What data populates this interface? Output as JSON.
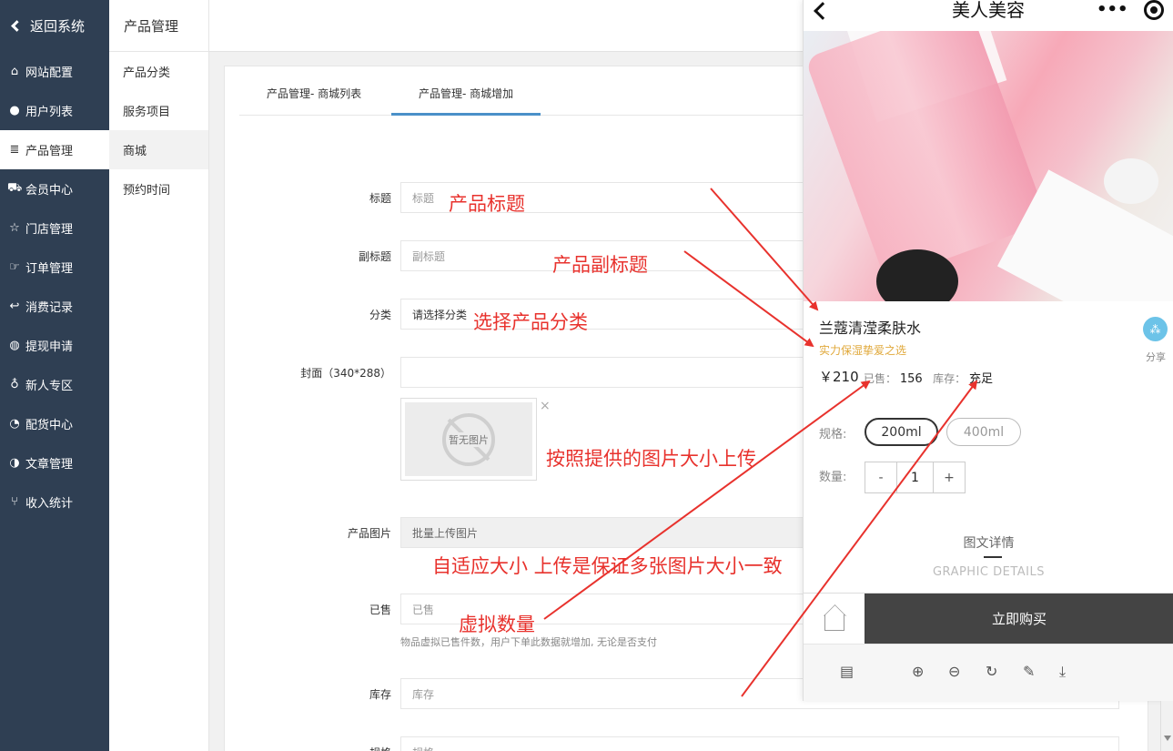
{
  "sidebar": {
    "back_label": "返回系统",
    "items": [
      {
        "label": "网站配置",
        "icon": "home-icon",
        "glyph": "⌂"
      },
      {
        "label": "用户列表",
        "icon": "user-icon",
        "glyph": "●"
      },
      {
        "label": "产品管理",
        "icon": "server-icon",
        "glyph": "≣"
      },
      {
        "label": "会员中心",
        "icon": "cart-icon",
        "glyph": "⛟"
      },
      {
        "label": "门店管理",
        "icon": "star-icon",
        "glyph": "☆"
      },
      {
        "label": "订单管理",
        "icon": "thumb-icon",
        "glyph": "☞"
      },
      {
        "label": "消费记录",
        "icon": "reply-icon",
        "glyph": "↩"
      },
      {
        "label": "提现申请",
        "icon": "wechat-icon",
        "glyph": "◍"
      },
      {
        "label": "新人专区",
        "icon": "pin-icon",
        "glyph": "♁"
      },
      {
        "label": "配货中心",
        "icon": "pie-icon",
        "glyph": "◔"
      },
      {
        "label": "文章管理",
        "icon": "contrast-icon",
        "glyph": "◑"
      },
      {
        "label": "收入统计",
        "icon": "fork-icon",
        "glyph": "⑂"
      }
    ]
  },
  "submenu": {
    "title": "产品管理",
    "items": [
      "产品分类",
      "服务项目",
      "商城",
      "预约时间"
    ]
  },
  "tabs": [
    "产品管理- 商城列表",
    "产品管理- 商城增加"
  ],
  "form": {
    "title_label": "标题",
    "title_placeholder": "标题",
    "subtitle_label": "副标题",
    "subtitle_placeholder": "副标题",
    "category_label": "分类",
    "category_value": "请选择分类",
    "cover_label": "封面（340*288）",
    "cover_noimg": "暂无图片",
    "cover_close": "×",
    "images_label": "产品图片",
    "images_button": "批量上传图片",
    "sold_label": "已售",
    "sold_placeholder": "已售",
    "sold_hint": "物品虚拟已售件数，用户下单此数据就增加, 无论是否支付",
    "stock_label": "库存",
    "stock_placeholder": "库存",
    "spec_label": "规格",
    "spec_placeholder": "规格"
  },
  "annotations": {
    "title": "产品标题",
    "subtitle": "产品副标题",
    "category": "选择产品分类",
    "cover": "按照提供的图片大小上传",
    "images": "自适应大小 上传是保证多张图片大小一致",
    "sold": "虚拟数量"
  },
  "phone": {
    "title": "美人美容",
    "dots": "•••",
    "product_name": "兰蔻清滢柔肤水",
    "product_sub": "实力保湿挚爱之选",
    "price": "￥210",
    "sold_label": "已售：",
    "sold_value": "156",
    "stock_label": "库存：",
    "stock_value": "充足",
    "share_label": "分享",
    "spec_label": "规格:",
    "specs": [
      "200ml",
      "400ml"
    ],
    "qty_label": "数量:",
    "qty_minus": "-",
    "qty_value": "1",
    "qty_plus": "+",
    "detail_title": "图文详情",
    "detail_en": "GRAPHIC DETAILS",
    "buy_label": "立即购买"
  },
  "colors": {
    "sidebar_bg": "#2f3f53",
    "tab_active": "#4a90c9",
    "annotation": "#e8322d",
    "subtitle_gold": "#e0a83a",
    "buy_bg": "#444444"
  }
}
